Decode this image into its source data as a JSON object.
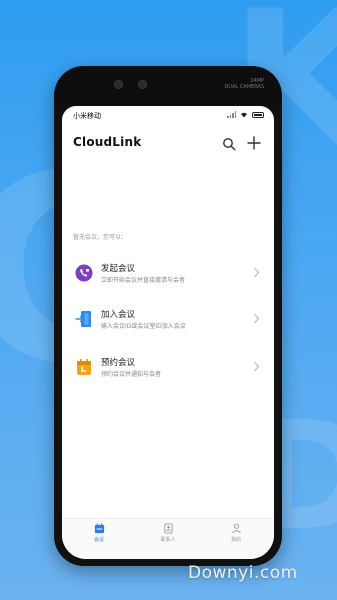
{
  "phone_sensor_text": [
    "24MP",
    "DUAL CAMERAS"
  ],
  "status": {
    "carrier": "小米移动"
  },
  "app": {
    "title": "CloudLink"
  },
  "empty_hint": "暂无会议，您可以：",
  "menu": [
    {
      "title": "发起会议",
      "desc": "立即开始会议并直接邀请与会者",
      "icon": "phone-video-icon",
      "color": "#7b3fbf"
    },
    {
      "title": "加入会议",
      "desc": "输入会议ID或会议室ID加入会议",
      "icon": "join-door-icon",
      "color": "#2d8ae8"
    },
    {
      "title": "预约会议",
      "desc": "预约会议并通知与会者",
      "icon": "calendar-icon",
      "color": "#f2a31b"
    }
  ],
  "tabs": [
    {
      "label": "会议",
      "icon": "calendar-tab-icon",
      "active": true
    },
    {
      "label": "联系人",
      "icon": "contacts-icon",
      "active": false
    },
    {
      "label": "我的",
      "icon": "person-icon",
      "active": false
    }
  ],
  "watermark": "Downyi.com",
  "colors": {
    "background": "#3aa1f0",
    "accent": "#2d7be5"
  }
}
